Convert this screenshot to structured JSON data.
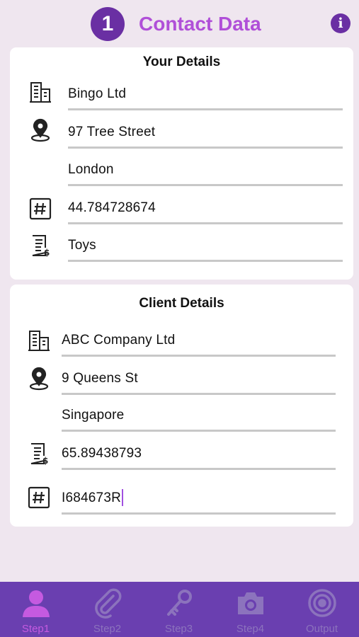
{
  "header": {
    "step_number": "1",
    "title": "Contact Data",
    "info_icon": "info-icon"
  },
  "your_details": {
    "title": "Your Details",
    "company": "Bingo Ltd",
    "address_line1": "97 Tree Street",
    "address_line2": "London",
    "number": "44.784728674",
    "category": "Toys"
  },
  "client_details": {
    "title": "Client Details",
    "company": "ABC Company Ltd",
    "address_line1": "9 Queens St",
    "address_line2": "Singapore",
    "phone": "65.89438793",
    "number": "I684673R"
  },
  "tabs": [
    {
      "label": "Step1",
      "icon": "person-icon",
      "active": true
    },
    {
      "label": "Step2",
      "icon": "paperclip-icon",
      "active": false
    },
    {
      "label": "Step3",
      "icon": "key-icon",
      "active": false
    },
    {
      "label": "Step4",
      "icon": "camera-icon",
      "active": false
    },
    {
      "label": "Output",
      "icon": "target-icon",
      "active": false
    }
  ],
  "colors": {
    "accent_purple": "#6a2fa3",
    "title_purple": "#b04fd8",
    "tabbar": "#6a3fb0",
    "background": "#efe6ef"
  }
}
